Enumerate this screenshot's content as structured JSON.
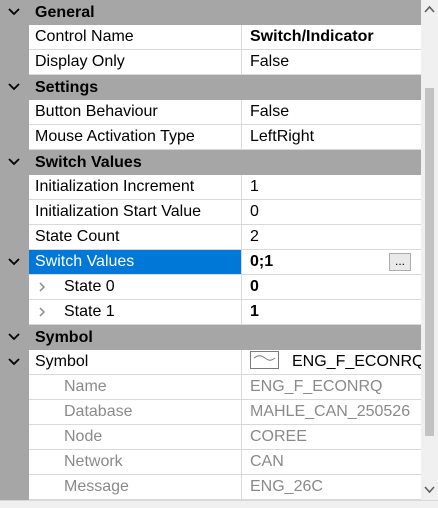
{
  "categories": {
    "general": "General",
    "settings": "Settings",
    "switch_values": "Switch Values",
    "symbol": "Symbol"
  },
  "props": {
    "control_name": {
      "name": "Control Name",
      "value": "Switch/Indicator"
    },
    "display_only": {
      "name": "Display Only",
      "value": "False"
    },
    "button_behaviour": {
      "name": "Button Behaviour",
      "value": "False"
    },
    "mouse_activation": {
      "name": "Mouse Activation Type",
      "value": "LeftRight"
    },
    "init_increment": {
      "name": "Initialization Increment",
      "value": "1"
    },
    "init_start": {
      "name": "Initialization Start Value",
      "value": "0"
    },
    "state_count": {
      "name": "State Count",
      "value": "2"
    },
    "switch_values": {
      "name": "Switch Values",
      "value": "0;1",
      "button": "..."
    },
    "state0": {
      "name": "State 0",
      "value": "0"
    },
    "state1": {
      "name": "State 1",
      "value": "1"
    },
    "symbol": {
      "name": "Symbol",
      "value": "ENG_F_ECONRQ"
    },
    "sym_name": {
      "name": "Name",
      "value": "ENG_F_ECONRQ"
    },
    "sym_database": {
      "name": "Database",
      "value": "MAHLE_CAN_250526"
    },
    "sym_node": {
      "name": "Node",
      "value": "COREE"
    },
    "sym_network": {
      "name": "Network",
      "value": "CAN"
    },
    "sym_message": {
      "name": "Message",
      "value": "ENG_26C"
    }
  },
  "colors": {
    "category_bg": "#a6a6a6",
    "selection": "#0078d7",
    "readonly_text": "#8a8a8a"
  }
}
